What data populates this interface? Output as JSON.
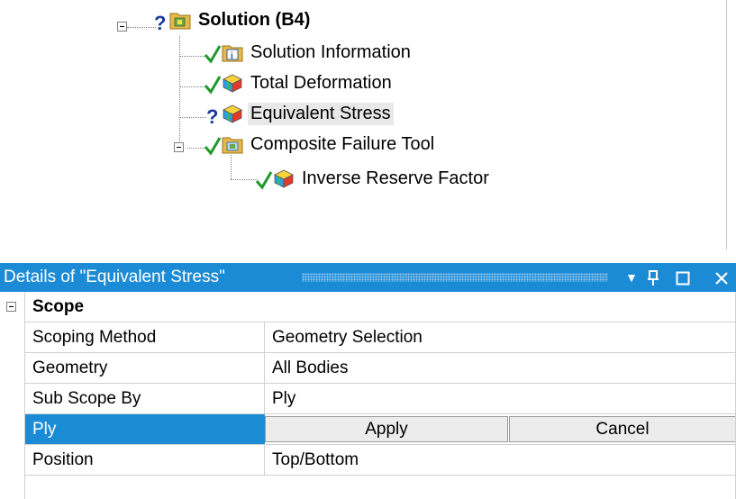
{
  "tree": {
    "nodes": [
      {
        "label": "Solution (B4)",
        "status": "question",
        "icon": "solution-folder-icon"
      },
      {
        "label": "Solution Information",
        "status": "check",
        "icon": "info-icon"
      },
      {
        "label": "Total Deformation",
        "status": "check",
        "icon": "result-cube-icon"
      },
      {
        "label": "Equivalent Stress",
        "status": "question",
        "icon": "result-cube-icon"
      },
      {
        "label": "Composite Failure Tool",
        "status": "check",
        "icon": "tool-folder-icon"
      },
      {
        "label": "Inverse Reserve Factor",
        "status": "check",
        "icon": "result-cube-icon"
      }
    ]
  },
  "details": {
    "title": "Details of \"Equivalent Stress\"",
    "controls": {
      "dropdown": "▼",
      "pin": "⊥",
      "maximize": "□",
      "close": "✕"
    },
    "category": "Scope",
    "rows": [
      {
        "name": "Scoping Method",
        "value": "Geometry Selection"
      },
      {
        "name": "Geometry",
        "value": "All Bodies"
      },
      {
        "name": "Sub Scope By",
        "value": "Ply"
      },
      {
        "name": "Ply",
        "apply": "Apply",
        "cancel": "Cancel"
      },
      {
        "name": "Position",
        "value": "Top/Bottom"
      }
    ]
  },
  "colors": {
    "accent": "#1c8bd6",
    "check": "#1f9a2a",
    "question": "#1a3a9a",
    "folder": "#e8b94a"
  }
}
